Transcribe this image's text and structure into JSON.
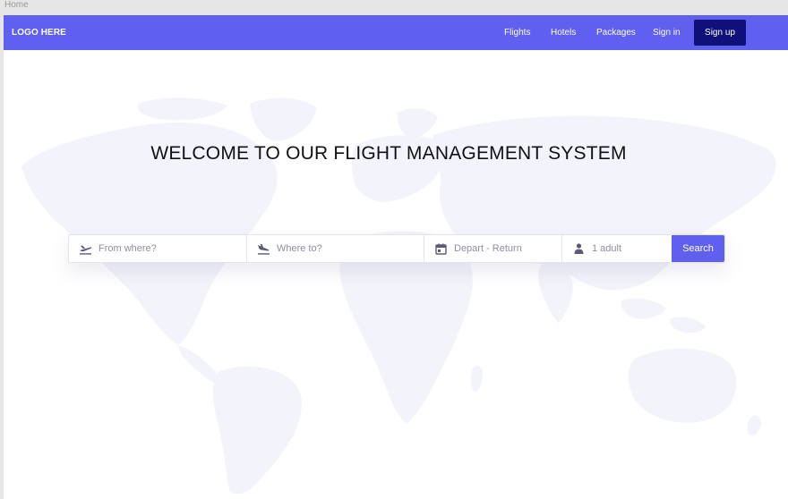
{
  "window": {
    "tab_title": "Home"
  },
  "navbar": {
    "logo": "LOGO HERE",
    "links": [
      "Flights",
      "Hotels",
      "Packages",
      "Sign in"
    ],
    "signup_label": "Sign up"
  },
  "hero": {
    "headline": "WELCOME TO OUR FLIGHT MANAGEMENT SYSTEM"
  },
  "search": {
    "from_placeholder": "From where?",
    "to_placeholder": "Where to?",
    "dates_placeholder": "Depart - Return",
    "passengers_value": "1 adult",
    "button_label": "Search"
  },
  "colors": {
    "accent": "#5f5ff0",
    "signup_bg": "#10107a",
    "map": "#f3f3fb"
  },
  "icons": [
    "takeoff-icon",
    "landing-icon",
    "calendar-icon",
    "person-icon"
  ]
}
